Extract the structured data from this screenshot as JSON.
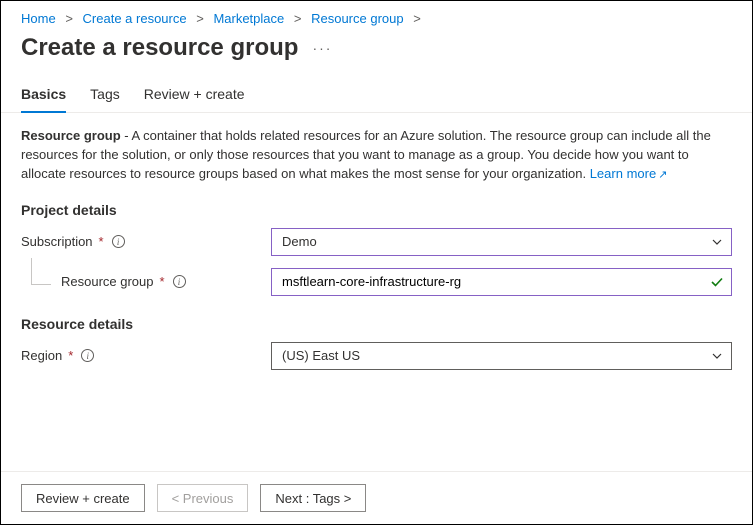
{
  "breadcrumb": {
    "items": [
      {
        "label": "Home"
      },
      {
        "label": "Create a resource"
      },
      {
        "label": "Marketplace"
      },
      {
        "label": "Resource group"
      }
    ]
  },
  "page": {
    "title": "Create a resource group"
  },
  "tabs": [
    {
      "label": "Basics",
      "active": true
    },
    {
      "label": "Tags",
      "active": false
    },
    {
      "label": "Review + create",
      "active": false
    }
  ],
  "description": {
    "label_bold": "Resource group",
    "text": " - A container that holds related resources for an Azure solution. The resource group can include all the resources for the solution, or only those resources that you want to manage as a group. You decide how you want to allocate resources to resource groups based on what makes the most sense for your organization. ",
    "learn_more": "Learn more"
  },
  "sections": {
    "project_details": {
      "heading": "Project details",
      "subscription": {
        "label": "Subscription",
        "value": "Demo"
      },
      "resource_group": {
        "label": "Resource group",
        "value": "msftlearn-core-infrastructure-rg"
      }
    },
    "resource_details": {
      "heading": "Resource details",
      "region": {
        "label": "Region",
        "value": "(US) East US"
      }
    }
  },
  "footer": {
    "review_create": "Review + create",
    "previous": "< Previous",
    "next": "Next : Tags >"
  }
}
